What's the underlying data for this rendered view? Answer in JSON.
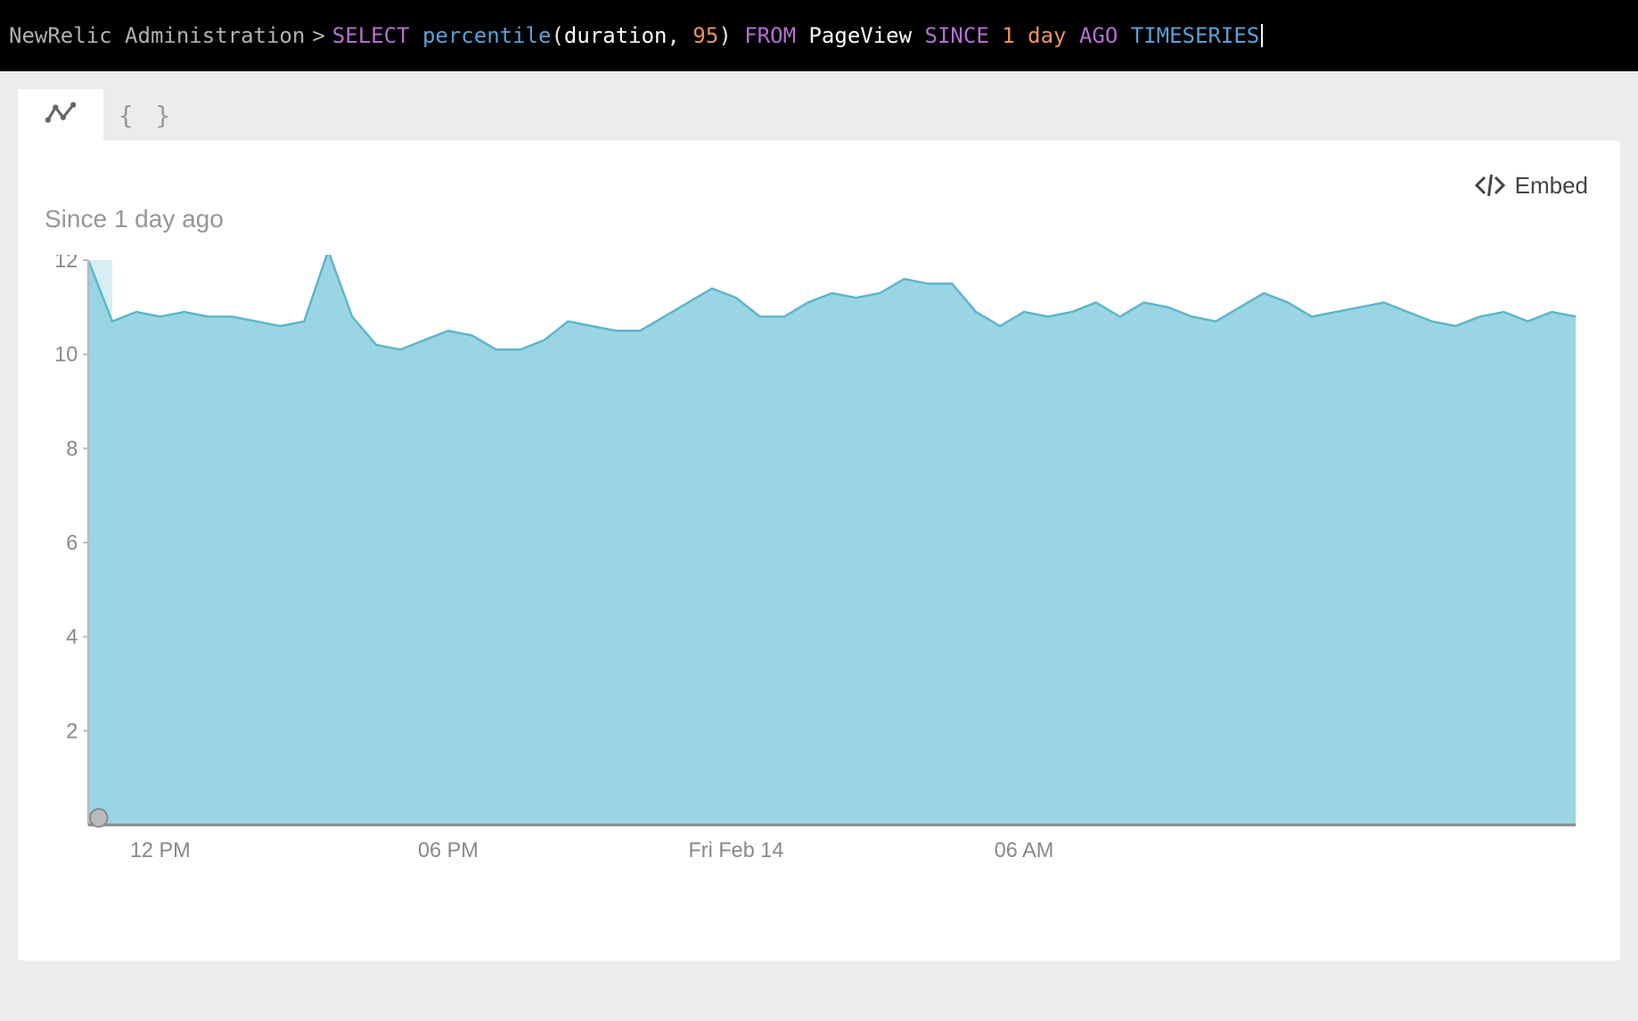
{
  "header": {
    "breadcrumb": "NewRelic Administration",
    "query_tokens": [
      {
        "text": "SELECT",
        "cls": "kw-select"
      },
      {
        "text": " ",
        "cls": ""
      },
      {
        "text": "percentile",
        "cls": "kw-fn"
      },
      {
        "text": "(",
        "cls": "kw-paren"
      },
      {
        "text": "duration",
        "cls": "kw-ident"
      },
      {
        "text": ", ",
        "cls": "kw-comma"
      },
      {
        "text": "95",
        "cls": "kw-num"
      },
      {
        "text": ")",
        "cls": "kw-paren"
      },
      {
        "text": " ",
        "cls": ""
      },
      {
        "text": "FROM",
        "cls": "kw-from"
      },
      {
        "text": " ",
        "cls": ""
      },
      {
        "text": "PageView",
        "cls": "kw-ident"
      },
      {
        "text": " ",
        "cls": ""
      },
      {
        "text": "SINCE",
        "cls": "kw-since"
      },
      {
        "text": " ",
        "cls": ""
      },
      {
        "text": "1",
        "cls": "kw-lit"
      },
      {
        "text": " ",
        "cls": ""
      },
      {
        "text": "day",
        "cls": "kw-lit"
      },
      {
        "text": " ",
        "cls": ""
      },
      {
        "text": "AGO",
        "cls": "kw-ago"
      },
      {
        "text": " ",
        "cls": ""
      },
      {
        "text": "TIMESERIES",
        "cls": "kw-timeseries"
      }
    ]
  },
  "tabs": {
    "chart_tab": "chart",
    "json_tab": "{ }"
  },
  "embed": {
    "label": "Embed"
  },
  "subtitle": "Since 1 day ago",
  "chart_data": {
    "type": "area",
    "title": "",
    "xlabel": "",
    "ylabel": "",
    "ylim": [
      0,
      12
    ],
    "y_ticks": [
      2,
      4,
      6,
      8,
      10,
      12
    ],
    "x_tick_labels": [
      "12 PM",
      "06 PM",
      "Fri Feb 14",
      "06 AM"
    ],
    "x_tick_positions": [
      3,
      15,
      27,
      39
    ],
    "series": [
      {
        "name": "percentile(duration, 95)",
        "color": "#95d3e2",
        "values": [
          12.0,
          10.7,
          10.9,
          10.8,
          10.9,
          10.8,
          10.8,
          10.7,
          10.6,
          10.7,
          12.2,
          10.8,
          10.2,
          10.1,
          10.3,
          10.5,
          10.4,
          10.1,
          10.1,
          10.3,
          10.7,
          10.6,
          10.5,
          10.5,
          10.8,
          11.1,
          11.4,
          11.2,
          10.8,
          10.8,
          11.1,
          11.3,
          11.2,
          11.3,
          11.6,
          11.5,
          11.5,
          10.9,
          10.6,
          10.9,
          10.8,
          10.9,
          11.1,
          10.8,
          11.1,
          11.0,
          10.8,
          10.7,
          11.0,
          11.3,
          11.1,
          10.8,
          10.9,
          11.0,
          11.1,
          10.9,
          10.7,
          10.6,
          10.8,
          10.9,
          10.7,
          10.9,
          10.8
        ]
      }
    ]
  }
}
